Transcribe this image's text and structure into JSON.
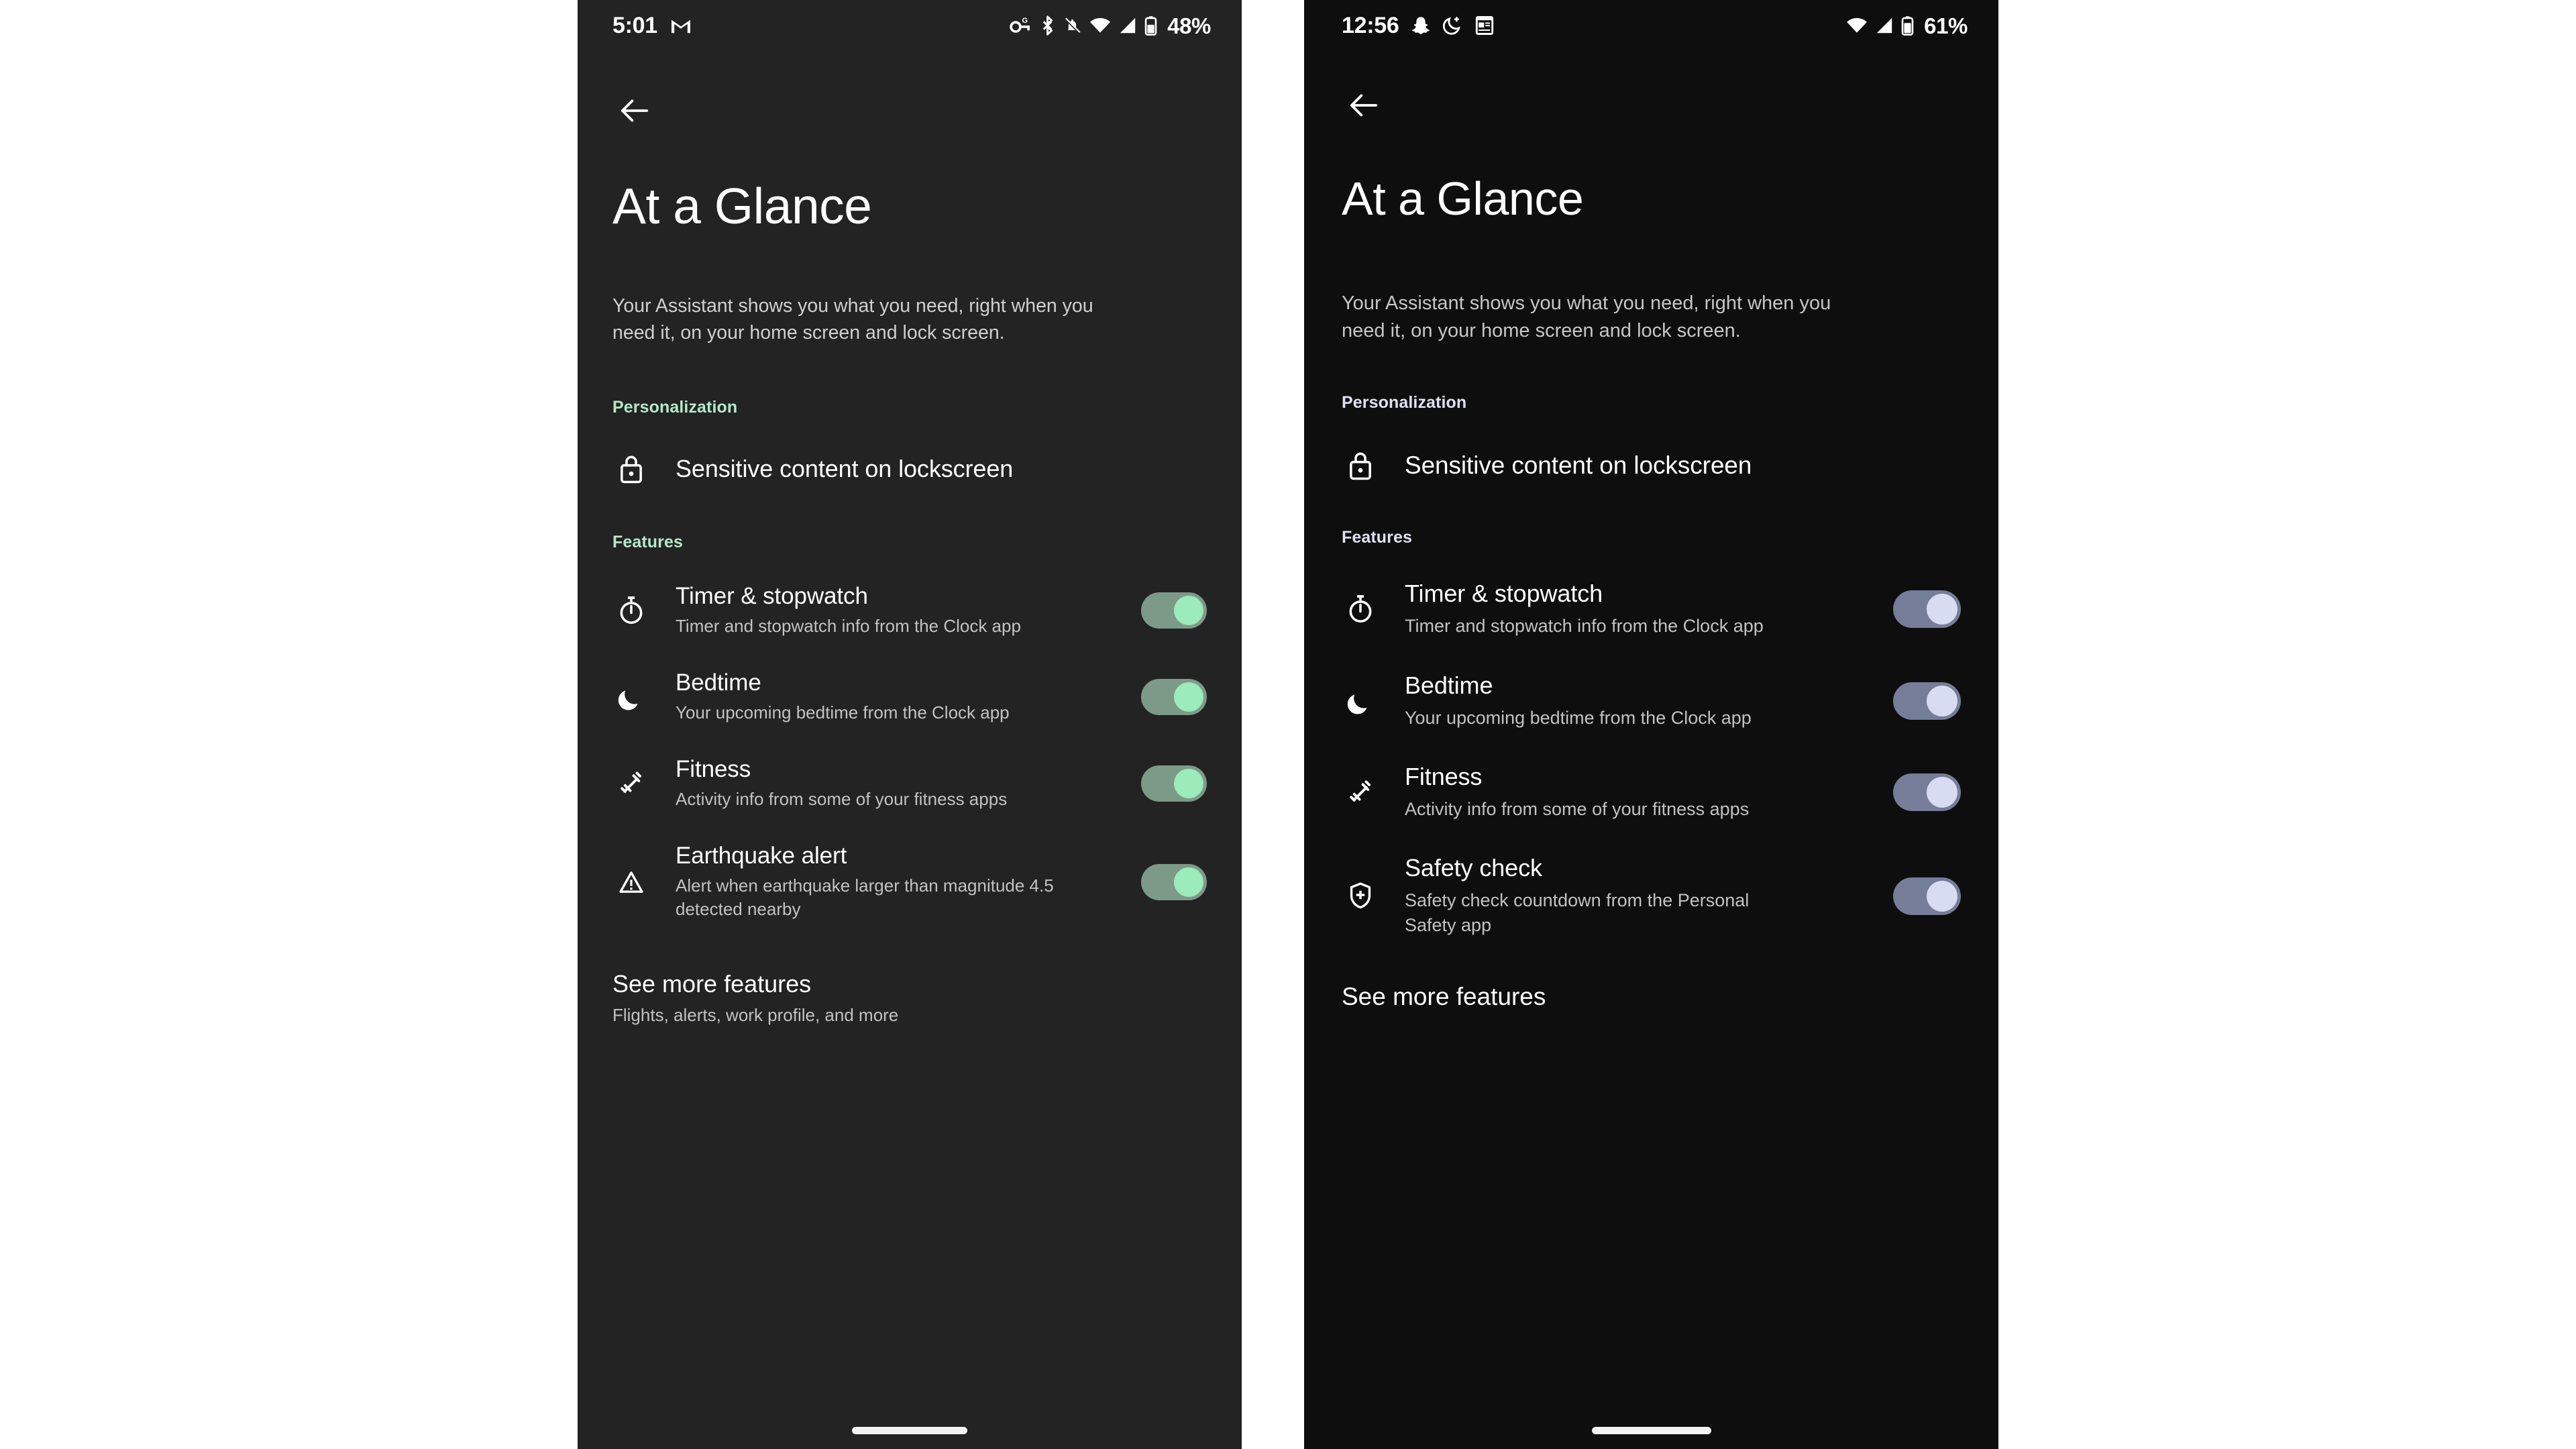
{
  "phones": [
    {
      "id": "left",
      "theme": {
        "background": "#232323",
        "accent": "#b5e8c8",
        "toggle_track": "#7d9a88",
        "toggle_thumb": "#9cebbb"
      },
      "status_bar": {
        "time": "5:01",
        "left_icons": [
          "gmail-icon"
        ],
        "right_icons": [
          "passkey-icon",
          "bluetooth-icon",
          "notifications-off-icon",
          "wifi-icon",
          "mobile-signal-icon",
          "battery-icon"
        ],
        "battery_percent": "48%"
      },
      "back_button": {
        "icon": "back-arrow-icon"
      },
      "title": "At a Glance",
      "description": "Your Assistant shows you what you need, right when you need it, on your home screen and lock screen.",
      "sections": [
        {
          "header": "Personalization",
          "rows": [
            {
              "icon": "lock-icon",
              "title": "Sensitive content on lockscreen",
              "subtitle": "",
              "toggle": null
            }
          ]
        },
        {
          "header": "Features",
          "rows": [
            {
              "icon": "stopwatch-icon",
              "title": "Timer & stopwatch",
              "subtitle": "Timer and stopwatch info from the Clock app",
              "toggle": "on"
            },
            {
              "icon": "moon-icon",
              "title": "Bedtime",
              "subtitle": "Your upcoming bedtime from the Clock app",
              "toggle": "on"
            },
            {
              "icon": "dumbbell-icon",
              "title": "Fitness",
              "subtitle": "Activity info from some of your fitness apps",
              "toggle": "on"
            },
            {
              "icon": "warning-triangle-icon",
              "title": "Earthquake alert",
              "subtitle": "Alert when earthquake larger than magnitude 4.5 detected nearby",
              "toggle": "on"
            }
          ]
        }
      ],
      "more": {
        "title": "See more features",
        "subtitle": "Flights, alerts, work profile, and more"
      }
    },
    {
      "id": "right",
      "theme": {
        "background": "#0e0e0e",
        "accent": "#dfe0f2",
        "toggle_track": "#767d99",
        "toggle_thumb": "#d8dcf3"
      },
      "status_bar": {
        "time": "12:56",
        "left_icons": [
          "snapchat-icon",
          "do-not-disturb-icon",
          "news-icon"
        ],
        "right_icons": [
          "wifi-icon",
          "mobile-signal-icon",
          "battery-icon"
        ],
        "battery_percent": "61%"
      },
      "back_button": {
        "icon": "back-arrow-icon"
      },
      "title": "At a Glance",
      "description": "Your Assistant shows you what you need, right when you need it, on your home screen and lock screen.",
      "sections": [
        {
          "header": "Personalization",
          "rows": [
            {
              "icon": "lock-icon",
              "title": "Sensitive content on lockscreen",
              "subtitle": "",
              "toggle": null
            }
          ]
        },
        {
          "header": "Features",
          "rows": [
            {
              "icon": "stopwatch-icon",
              "title": "Timer & stopwatch",
              "subtitle": "Timer and stopwatch info from the Clock app",
              "toggle": "on"
            },
            {
              "icon": "moon-icon",
              "title": "Bedtime",
              "subtitle": "Your upcoming bedtime from the Clock app",
              "toggle": "on"
            },
            {
              "icon": "dumbbell-icon",
              "title": "Fitness",
              "subtitle": "Activity info from some of your fitness apps",
              "toggle": "on"
            },
            {
              "icon": "shield-check-icon",
              "title": "Safety check",
              "subtitle": "Safety check countdown from the Personal Safety app",
              "toggle": "on"
            }
          ]
        }
      ],
      "more": {
        "title": "See more features",
        "subtitle": ""
      }
    }
  ]
}
